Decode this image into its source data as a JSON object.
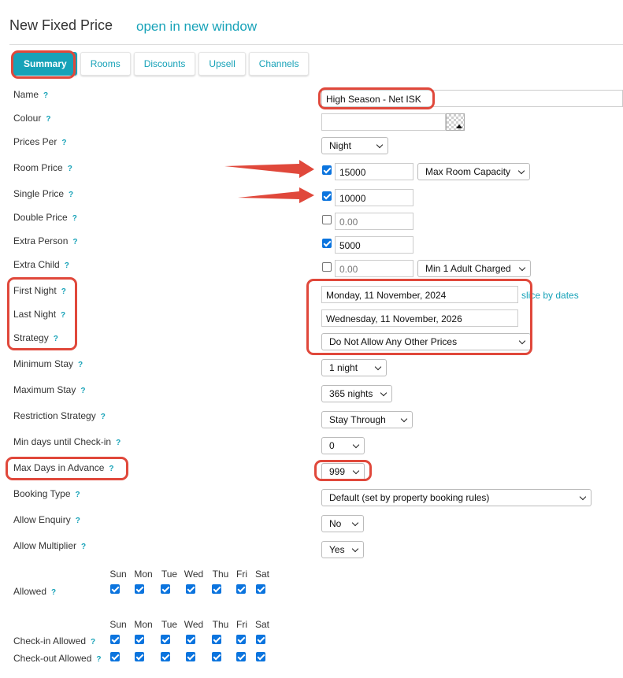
{
  "header": {
    "title": "New Fixed Price",
    "open_link": "open in new window"
  },
  "tabs": [
    "Summary",
    "Rooms",
    "Discounts",
    "Upsell",
    "Channels"
  ],
  "help_marker": "?",
  "labels": {
    "name": "Name",
    "colour": "Colour",
    "prices_per": "Prices Per",
    "room_price": "Room Price",
    "single_price": "Single Price",
    "double_price": "Double Price",
    "extra_person": "Extra Person",
    "extra_child": "Extra Child",
    "first_night": "First Night",
    "last_night": "Last Night",
    "strategy": "Strategy",
    "minimum_stay": "Minimum Stay",
    "maximum_stay": "Maximum Stay",
    "restriction_strategy": "Restriction Strategy",
    "min_days_checkin": "Min days until Check-in",
    "max_days_advance": "Max Days in Advance",
    "booking_type": "Booking Type",
    "allow_enquiry": "Allow Enquiry",
    "allow_multiplier": "Allow Multiplier",
    "allowed": "Allowed",
    "checkin_allowed": "Check-in Allowed",
    "checkout_allowed": "Check-out Allowed"
  },
  "fields": {
    "name_value": "High Season - Net ISK",
    "colour_value": "",
    "prices_per": "Night",
    "room_price": {
      "checked": true,
      "value": "15000",
      "mode": "Max Room Capacity"
    },
    "single_price": {
      "checked": true,
      "value": "10000"
    },
    "double_price": {
      "checked": false,
      "placeholder": "0.00"
    },
    "extra_person": {
      "checked": true,
      "value": "5000"
    },
    "extra_child": {
      "checked": false,
      "placeholder": "0.00",
      "mode": "Min 1 Adult Charged"
    },
    "first_night": "Monday, 11 November, 2024",
    "slice_link": "slice by dates",
    "last_night": "Wednesday, 11 November, 2026",
    "strategy": "Do Not Allow Any Other Prices",
    "minimum_stay": "1 night",
    "maximum_stay": "365 nights",
    "restriction_strategy": "Stay Through",
    "min_days_checkin": "0",
    "max_days_advance": "999",
    "booking_type": "Default (set by property booking rules)",
    "allow_enquiry": "No",
    "allow_multiplier": "Yes"
  },
  "days": [
    "Sun",
    "Mon",
    "Tue",
    "Wed",
    "Thu",
    "Fri",
    "Sat"
  ],
  "day_checks": {
    "allowed": [
      true,
      true,
      true,
      true,
      true,
      true,
      true
    ],
    "checkin": [
      true,
      true,
      true,
      true,
      true,
      true,
      true
    ],
    "checkout": [
      true,
      true,
      true,
      true,
      true,
      true,
      true
    ]
  },
  "colors": {
    "accent": "#17a2b8",
    "annotation": "#e0483b",
    "checkbox": "#0b74de"
  }
}
